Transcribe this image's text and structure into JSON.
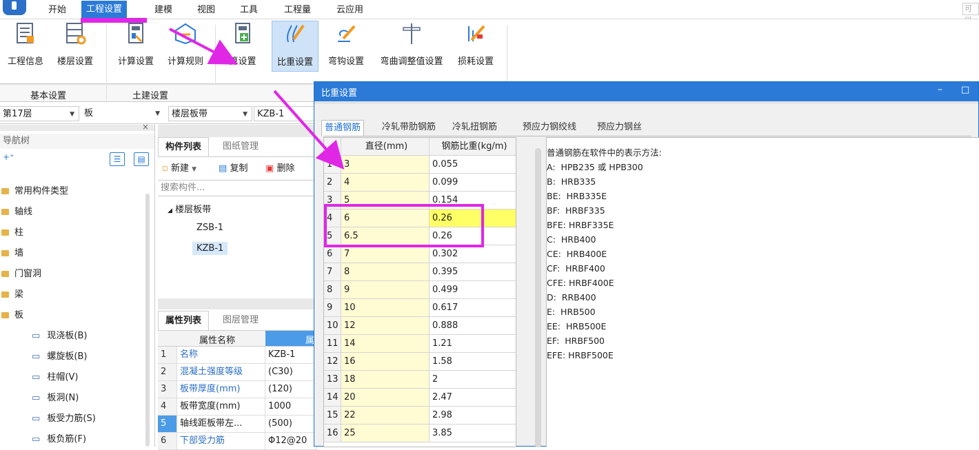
{
  "menubar": {
    "items": [
      "开始",
      "工程设置",
      "建模",
      "视图",
      "工具",
      "工程量",
      "云应用"
    ],
    "active": "工程设置",
    "right_text": "可以"
  },
  "ribbon": {
    "buttons": [
      {
        "label": "工程信息",
        "icon": "project-info-icon"
      },
      {
        "label": "楼层设置",
        "icon": "floor-settings-icon"
      },
      {
        "label": "计算设置",
        "icon": "calc-settings-icon"
      },
      {
        "label": "计算规则",
        "icon": "calc-rules-icon"
      },
      {
        "label": "算设置",
        "icon": "settings-doc-icon"
      },
      {
        "label": "比重设置",
        "icon": "density-settings-icon"
      },
      {
        "label": "弯钩设置",
        "icon": "hook-settings-icon"
      },
      {
        "label": "弯曲调整值设置",
        "icon": "bend-adjust-icon"
      },
      {
        "label": "损耗设置",
        "icon": "loss-settings-icon"
      }
    ],
    "selected": "比重设置",
    "groups": [
      "基本设置",
      "土建设置"
    ]
  },
  "selectors": {
    "floor": "第17层",
    "type": "板",
    "sub": "楼层板带",
    "item": "KZB-1"
  },
  "nav": {
    "title": "导航树",
    "items": [
      {
        "label": "常用构件类型",
        "folder": true
      },
      {
        "label": "轴线",
        "folder": true
      },
      {
        "label": "柱",
        "folder": true
      },
      {
        "label": "墙",
        "folder": true
      },
      {
        "label": "门窗洞",
        "folder": true
      },
      {
        "label": "梁",
        "folder": true
      },
      {
        "label": "板",
        "folder": true
      },
      {
        "label": "现浇板(B)",
        "folder": false
      },
      {
        "label": "螺旋板(B)",
        "folder": false
      },
      {
        "label": "柱帽(V)",
        "folder": false
      },
      {
        "label": "板洞(N)",
        "folder": false
      },
      {
        "label": "板受力筋(S)",
        "folder": false
      },
      {
        "label": "板负筋(F)",
        "folder": false
      }
    ]
  },
  "components": {
    "tabs": [
      "构件列表",
      "图纸管理"
    ],
    "new": "新建",
    "copy": "复制",
    "delete": "删除",
    "search_placeholder": "搜索构件...",
    "group": "楼层板带",
    "items": [
      "ZSB-1",
      "KZB-1"
    ]
  },
  "props": {
    "tabs": [
      "属性列表",
      "图层管理"
    ],
    "col": "属性名称",
    "col2": "属",
    "rows": [
      {
        "n": "1",
        "name": "名称",
        "val": "KZB-1"
      },
      {
        "n": "2",
        "name": "混凝土强度等级",
        "val": "(C30)"
      },
      {
        "n": "3",
        "name": "板带厚度(mm)",
        "val": "(120)"
      },
      {
        "n": "4",
        "name": "板带宽度(mm)",
        "val": "1000"
      },
      {
        "n": "5",
        "name": "轴线距板带左...",
        "val": "(500)"
      },
      {
        "n": "6",
        "name": "下部受力筋",
        "val": "Φ12@20"
      }
    ]
  },
  "dialog": {
    "title": "比重设置",
    "min": "–",
    "max": "□",
    "tabs": [
      "普通钢筋",
      "冷轧带肋钢筋",
      "冷轧扭钢筋",
      "预应力钢绞线",
      "预应力钢丝"
    ],
    "col_diameter": "直径(mm)",
    "col_density": "钢筋比重(kg/m)",
    "rows": [
      {
        "n": "1",
        "d": "3",
        "w": "0.055"
      },
      {
        "n": "2",
        "d": "4",
        "w": "0.099"
      },
      {
        "n": "3",
        "d": "5",
        "w": "0.154"
      },
      {
        "n": "4",
        "d": "6",
        "w": "0.26"
      },
      {
        "n": "5",
        "d": "6.5",
        "w": "0.26"
      },
      {
        "n": "6",
        "d": "7",
        "w": "0.302"
      },
      {
        "n": "7",
        "d": "8",
        "w": "0.395"
      },
      {
        "n": "8",
        "d": "9",
        "w": "0.499"
      },
      {
        "n": "9",
        "d": "10",
        "w": "0.617"
      },
      {
        "n": "10",
        "d": "12",
        "w": "0.888"
      },
      {
        "n": "11",
        "d": "14",
        "w": "1.21"
      },
      {
        "n": "12",
        "d": "16",
        "w": "1.58"
      },
      {
        "n": "13",
        "d": "18",
        "w": "2"
      },
      {
        "n": "14",
        "d": "20",
        "w": "2.47"
      },
      {
        "n": "15",
        "d": "22",
        "w": "2.98"
      },
      {
        "n": "16",
        "d": "25",
        "w": "3.85"
      }
    ],
    "selected_row": "4",
    "notes_title": "普通钢筋在软件中的表示方法:",
    "notes": [
      "A:  HPB235 或 HPB300",
      "B:  HRB335",
      "BE:  HRB335E",
      "BF:  HRBF335",
      "BFE: HRBF335E",
      "C:  HRB400",
      "CE:  HRB400E",
      "CF:  HRBF400",
      "CFE: HRBF400E",
      "D:  RRB400",
      "E:  HRB500",
      "EE:  HRB500E",
      "EF:  HRBF500",
      "EFE: HRBF500E"
    ]
  },
  "colors": {
    "accent": "#2b7ad8",
    "highlight": "#e027e6",
    "yellow_cell": "#fffbd3",
    "selected_cell": "#ffff66"
  }
}
